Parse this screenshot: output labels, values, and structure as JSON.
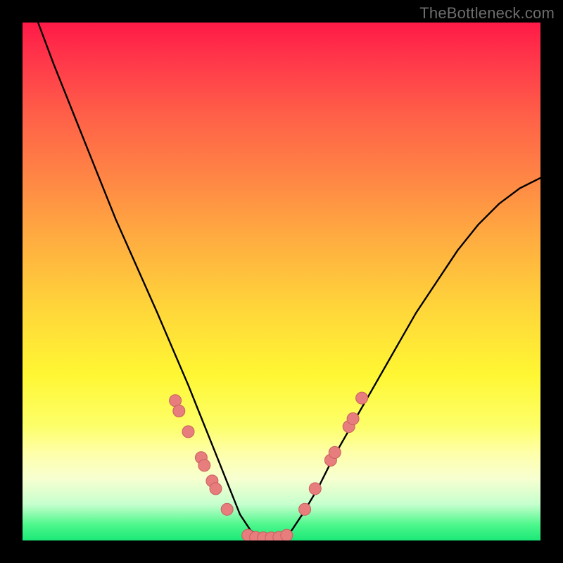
{
  "watermark": "TheBottleneck.com",
  "colors": {
    "frame": "#000000",
    "curve": "#000000",
    "dot_fill": "#e77d7d",
    "dot_stroke": "#c9605f",
    "gradient_top": "#ff1a47",
    "gradient_bottom": "#1be877"
  },
  "chart_data": {
    "type": "line",
    "title": "",
    "xlabel": "",
    "ylabel": "",
    "xlim": [
      0,
      100
    ],
    "ylim": [
      0,
      100
    ],
    "note": "Axes unlabeled; x is normalized horizontal position (0 left, 100 right), y is normalized bottleneck percent (0 bottom/green = best match, 100 top/red = severe bottleneck). Values estimated from pixel positions.",
    "series": [
      {
        "name": "bottleneck-curve",
        "x": [
          0,
          3,
          6,
          10,
          14,
          18,
          22,
          26,
          29,
          32,
          34,
          36,
          38,
          40,
          42,
          44,
          46,
          48,
          50,
          52,
          54,
          57,
          60,
          64,
          68,
          72,
          76,
          80,
          84,
          88,
          92,
          96,
          100
        ],
        "y": [
          108,
          100,
          92,
          82,
          72,
          62,
          53,
          44,
          37,
          30,
          25,
          20,
          15,
          10,
          5,
          2,
          0.5,
          0.5,
          0.5,
          2,
          5,
          10,
          16,
          23,
          30,
          37,
          44,
          50,
          56,
          61,
          65,
          68,
          70
        ]
      }
    ],
    "scatter": [
      {
        "name": "left-cluster",
        "points": [
          {
            "x": 29.5,
            "y": 27.0
          },
          {
            "x": 30.2,
            "y": 25.0
          },
          {
            "x": 32.0,
            "y": 21.0
          },
          {
            "x": 34.5,
            "y": 16.0
          },
          {
            "x": 35.1,
            "y": 14.5
          },
          {
            "x": 36.6,
            "y": 11.5
          },
          {
            "x": 37.3,
            "y": 10.0
          },
          {
            "x": 39.5,
            "y": 6.0
          }
        ]
      },
      {
        "name": "valley-cluster",
        "points": [
          {
            "x": 43.5,
            "y": 1.0
          },
          {
            "x": 45.0,
            "y": 0.6
          },
          {
            "x": 46.5,
            "y": 0.5
          },
          {
            "x": 48.0,
            "y": 0.5
          },
          {
            "x": 49.5,
            "y": 0.6
          },
          {
            "x": 51.0,
            "y": 1.0
          }
        ]
      },
      {
        "name": "right-cluster",
        "points": [
          {
            "x": 54.5,
            "y": 6.0
          },
          {
            "x": 56.5,
            "y": 10.0
          },
          {
            "x": 59.5,
            "y": 15.5
          },
          {
            "x": 60.3,
            "y": 17.0
          },
          {
            "x": 63.0,
            "y": 22.0
          },
          {
            "x": 63.8,
            "y": 23.5
          },
          {
            "x": 65.5,
            "y": 27.5
          }
        ]
      }
    ]
  }
}
